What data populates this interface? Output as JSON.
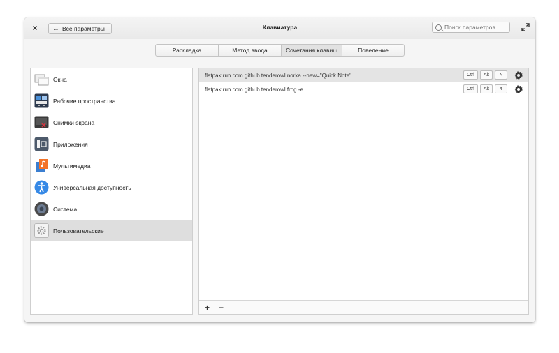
{
  "window": {
    "title": "Клавиатура",
    "back_label": "Все параметры",
    "close_glyph": "×",
    "search_placeholder": "Поиск параметров"
  },
  "tabs": [
    {
      "label": "Раскладка",
      "active": false
    },
    {
      "label": "Метод ввода",
      "active": false
    },
    {
      "label": "Сочетания клавиш",
      "active": true
    },
    {
      "label": "Поведение",
      "active": false
    }
  ],
  "sidebar": {
    "items": [
      {
        "label": "Окна",
        "icon": "windows-icon"
      },
      {
        "label": "Рабочие пространства",
        "icon": "workspaces-icon"
      },
      {
        "label": "Снимки экрана",
        "icon": "screenshot-icon"
      },
      {
        "label": "Приложения",
        "icon": "applications-icon"
      },
      {
        "label": "Мультимедиа",
        "icon": "multimedia-icon"
      },
      {
        "label": "Универсальная доступность",
        "icon": "accessibility-icon"
      },
      {
        "label": "Система",
        "icon": "system-icon"
      },
      {
        "label": "Пользовательские",
        "icon": "custom-icon",
        "selected": true
      }
    ]
  },
  "shortcuts": [
    {
      "command": "flatpak run com.github.tenderowl.norka --new=\"Quick Note\"",
      "keys": [
        "Ctrl",
        "Alt",
        "N"
      ],
      "selected": true
    },
    {
      "command": "flatpak run com.github.tenderowl.frog -e",
      "keys": [
        "Ctrl",
        "Alt",
        "4"
      ],
      "selected": false
    }
  ],
  "bottombar": {
    "add_label": "+",
    "remove_label": "−"
  },
  "colors": {
    "accent_blue": "#3689e6",
    "selected_row": "#e4e4e4",
    "selected_sidebar": "#dedede"
  }
}
